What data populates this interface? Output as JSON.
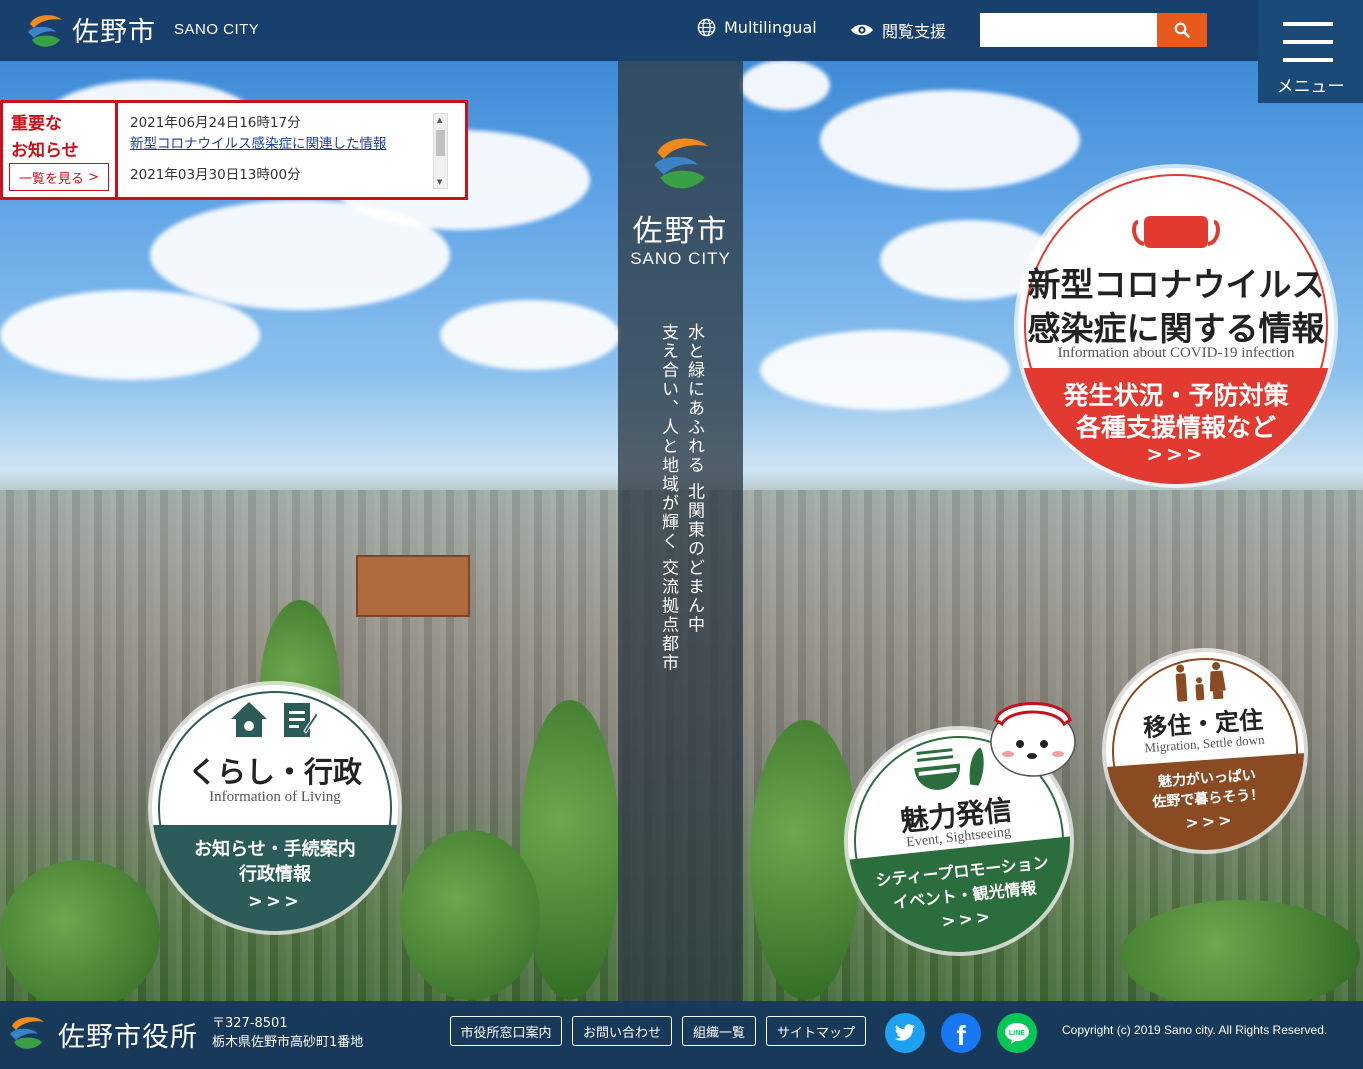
{
  "header": {
    "title": "佐野市",
    "subtitle": "SANO CITY",
    "multilingual": "Multilingual",
    "accessibility": "閲覧支援",
    "search_placeholder": "",
    "menu_label": "メニュー"
  },
  "notice": {
    "title_line1": "重要な",
    "title_line2": "お知らせ",
    "view_all": "一覧を見る",
    "items": [
      {
        "date": "2021年06月24日16時17分",
        "link": "新型コロナウイルス感染症に関連した情報"
      },
      {
        "date": "2021年03月30日13時00分",
        "link": ""
      }
    ]
  },
  "center": {
    "title": "佐野市",
    "subtitle": "SANO CITY",
    "tagline_line1": "水と緑にあふれる 北関東のどまん中",
    "tagline_line2": "支え合い、人と地域が輝く 交流拠点都市"
  },
  "banners": {
    "covid": {
      "title_line1": "新型コロナウイルス",
      "title_line2": "感染症に関する情報",
      "en": "Information about COVID-19 infection",
      "sub_line1": "発生状況・予防対策",
      "sub_line2": "各種支援情報など",
      "arrows": ">>>"
    },
    "living": {
      "title": "くらし・行政",
      "en": "Information of Living",
      "sub_line1": "お知らせ・手続案内",
      "sub_line2": "行政情報",
      "arrows": ">>>"
    },
    "miryoku": {
      "title": "魅力発信",
      "en": "Event, Sightseeing",
      "sub_line1": "シティープロモーション",
      "sub_line2": "イベント・観光情報",
      "arrows": ">>>"
    },
    "iju": {
      "title": "移住・定住",
      "en": "Migration, Settle down",
      "sub_line1": "魅力がいっぱい",
      "sub_line2": "佐野で暮らそう！",
      "arrows": ">>>"
    }
  },
  "footer": {
    "title": "佐野市役所",
    "postal": "〒327-8501",
    "address": "栃木県佐野市高砂町1番地",
    "links": [
      "市役所窓口案内",
      "お問い合わせ",
      "組織一覧",
      "サイトマップ"
    ],
    "copyright": "Copyright (c) 2019 Sano city. All Rights Reserved."
  },
  "colors": {
    "header_bg": "#14375f",
    "search_button": "#e85a1b",
    "notice_red": "#c8111d",
    "covid_red": "#e23a31",
    "living_green": "#2c5c5a",
    "miryoku_green": "#2b6d3c",
    "iju_brown": "#8a4b22"
  },
  "icons": [
    "globe-icon",
    "eye-icon",
    "search-icon",
    "hamburger-icon",
    "mask-icon",
    "house-icon",
    "document-icon",
    "ramen-icon",
    "family-icon",
    "twitter-icon",
    "facebook-icon",
    "line-icon"
  ]
}
